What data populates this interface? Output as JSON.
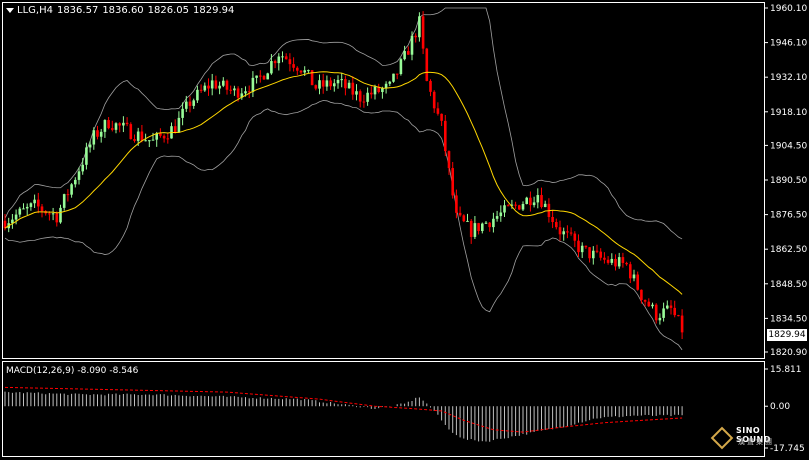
{
  "header": {
    "symbol_tf": "LLG,H4",
    "open": "1836.57",
    "high": "1836.60",
    "low": "1826.05",
    "close": "1829.94"
  },
  "macd_header": {
    "label": "MACD(12,26,9)",
    "macd": "-8.090",
    "signal": "-8.546"
  },
  "logo": {
    "line1": "SINO SOUND",
    "line2": "漢聲集團"
  },
  "colors": {
    "bull": "#ffffff",
    "bear": "#ff0000",
    "bull_fill": "#98fb98",
    "ma": "#ffd700",
    "bands": "#a0a0a0",
    "signal": "#ff0000",
    "macd_bars": "#c0c0c0",
    "grid": "#ffffff"
  },
  "chart_data": {
    "type": "candlestick",
    "price_axis": {
      "ticks": [
        "1960.10",
        "1946.10",
        "1932.10",
        "1918.10",
        "1904.50",
        "1890.50",
        "1876.50",
        "1862.50",
        "1848.50",
        "1834.50",
        "1820.90"
      ],
      "ylim": [
        1820.9,
        1960.1
      ],
      "last_price": "1829.94"
    },
    "macd_axis": {
      "ticks": [
        "15.811",
        "0.00",
        "-17.745"
      ],
      "ylim": [
        -17.745,
        15.811
      ]
    },
    "anchors": [
      [
        0,
        1874
      ],
      [
        8,
        1880
      ],
      [
        14,
        1876
      ],
      [
        20,
        1895
      ],
      [
        24,
        1908
      ],
      [
        28,
        1914
      ],
      [
        34,
        1910
      ],
      [
        40,
        1906
      ],
      [
        46,
        1912
      ],
      [
        50,
        1922
      ],
      [
        56,
        1930
      ],
      [
        62,
        1926
      ],
      [
        68,
        1930
      ],
      [
        74,
        1942
      ],
      [
        80,
        1936
      ],
      [
        84,
        1928
      ],
      [
        90,
        1930
      ],
      [
        96,
        1924
      ],
      [
        100,
        1926
      ],
      [
        104,
        1928
      ],
      [
        108,
        1940
      ],
      [
        112,
        1954
      ],
      [
        114,
        1930
      ],
      [
        118,
        1912
      ],
      [
        122,
        1875
      ],
      [
        126,
        1870
      ],
      [
        132,
        1875
      ],
      [
        138,
        1880
      ],
      [
        144,
        1885
      ],
      [
        150,
        1870
      ],
      [
        156,
        1862
      ],
      [
        162,
        1858
      ],
      [
        168,
        1856
      ],
      [
        172,
        1844
      ],
      [
        176,
        1836
      ],
      [
        180,
        1838
      ],
      [
        183,
        1830
      ]
    ],
    "macd_anchors": [
      [
        0,
        6
      ],
      [
        20,
        5
      ],
      [
        40,
        5
      ],
      [
        60,
        4
      ],
      [
        80,
        3
      ],
      [
        90,
        1
      ],
      [
        100,
        -1
      ],
      [
        108,
        1
      ],
      [
        112,
        4
      ],
      [
        116,
        -2
      ],
      [
        120,
        -10
      ],
      [
        124,
        -14
      ],
      [
        130,
        -15
      ],
      [
        140,
        -12
      ],
      [
        150,
        -9
      ],
      [
        160,
        -5
      ],
      [
        170,
        -4
      ],
      [
        183,
        -4
      ]
    ],
    "signal_anchors": [
      [
        0,
        8
      ],
      [
        30,
        7
      ],
      [
        60,
        6
      ],
      [
        85,
        3
      ],
      [
        100,
        0
      ],
      [
        110,
        -1
      ],
      [
        118,
        -2
      ],
      [
        124,
        -6
      ],
      [
        132,
        -10
      ],
      [
        140,
        -11
      ],
      [
        150,
        -9
      ],
      [
        162,
        -7
      ],
      [
        172,
        -6
      ],
      [
        183,
        -5
      ]
    ],
    "n_candles": 184
  }
}
